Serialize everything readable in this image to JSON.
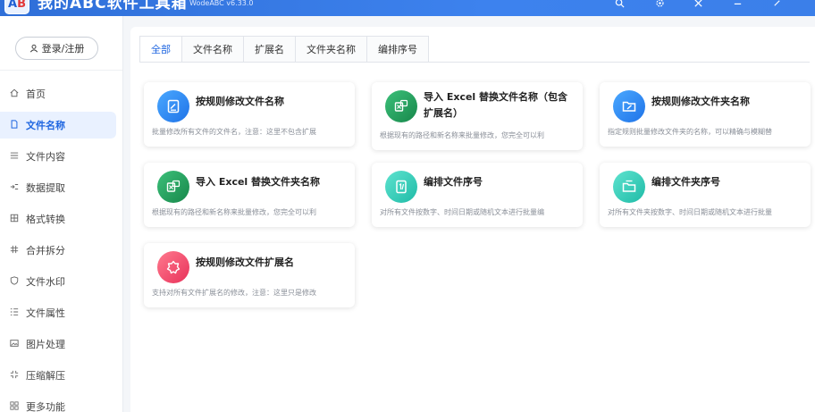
{
  "app": {
    "logo_a": "A",
    "logo_b": "B",
    "title": "我的ABC软件工具箱",
    "version": "WodeABC v6.33.0"
  },
  "sidebar": {
    "login_label": "登录/注册",
    "items": [
      {
        "label": "首页",
        "icon": "home-icon"
      },
      {
        "label": "文件名称",
        "icon": "file-icon"
      },
      {
        "label": "文件内容",
        "icon": "list-icon"
      },
      {
        "label": "数据提取",
        "icon": "extract-icon"
      },
      {
        "label": "格式转换",
        "icon": "grid-icon"
      },
      {
        "label": "合并拆分",
        "icon": "hash-icon"
      },
      {
        "label": "文件水印",
        "icon": "shield-icon"
      },
      {
        "label": "文件属性",
        "icon": "lines-icon"
      },
      {
        "label": "图片处理",
        "icon": "image-icon"
      },
      {
        "label": "压缩解压",
        "icon": "compress-icon"
      },
      {
        "label": "更多功能",
        "icon": "apps-icon"
      }
    ]
  },
  "tabs": [
    "全部",
    "文件名称",
    "扩展名",
    "文件夹名称",
    "编排序号"
  ],
  "cards": [
    {
      "title": "按规则修改文件名称",
      "desc": "批量修改所有文件的文件名，注意：这里不包含扩展",
      "color": "#2f8bf0"
    },
    {
      "title": "导入 Excel 替换文件名称（包含扩展名）",
      "desc": "根据现有的路径和新名称来批量修改，您完全可以利",
      "color": "#1f9e5b"
    },
    {
      "title": "按规则修改文件夹名称",
      "desc": "指定规则批量修改文件夹的名称，可以精确与模糊替",
      "color": "#2f8bf0"
    },
    {
      "title": "导入 Excel 替换文件夹名称",
      "desc": "根据现有的路径和新名称来批量修改，您完全可以利",
      "color": "#1f9e5b"
    },
    {
      "title": "编排文件序号",
      "desc": "对所有文件按数字、时间日期或随机文本进行批量编",
      "color": "#2ed3c0"
    },
    {
      "title": "编排文件夹序号",
      "desc": "对所有文件夹按数字、时间日期或随机文本进行批量",
      "color": "#2ed3c0"
    },
    {
      "title": "按规则修改文件扩展名",
      "desc": "支持对所有文件扩展名的修改，注意：这里只是修改",
      "color": "#f0486a"
    }
  ]
}
